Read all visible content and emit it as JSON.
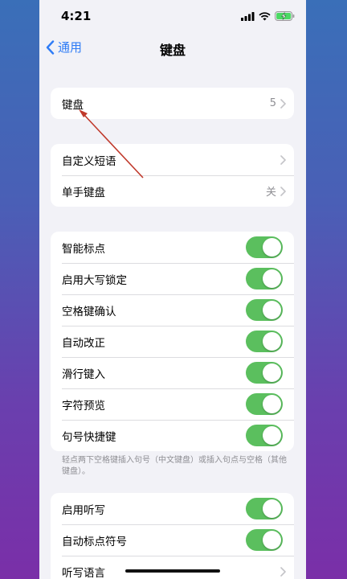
{
  "status": {
    "time": "4:21"
  },
  "nav": {
    "back_label": "通用",
    "title": "键盘"
  },
  "group1": {
    "keyboards": {
      "label": "键盘",
      "value": "5"
    }
  },
  "group2": {
    "text_replacement": {
      "label": "自定义短语"
    },
    "one_handed": {
      "label": "单手键盘",
      "value": "关"
    }
  },
  "toggles": [
    {
      "label": "智能标点",
      "on": true
    },
    {
      "label": "启用大写锁定",
      "on": true
    },
    {
      "label": "空格键确认",
      "on": true
    },
    {
      "label": "自动改正",
      "on": true
    },
    {
      "label": "滑行键入",
      "on": true
    },
    {
      "label": "字符预览",
      "on": true
    },
    {
      "label": "句号快捷键",
      "on": true
    }
  ],
  "footnote": "轻点两下空格键插入句号（中文键盘）或插入句点与空格（其他键盘）。",
  "dictation": {
    "enable": {
      "label": "启用听写",
      "on": true
    },
    "auto_punct": {
      "label": "自动标点符号",
      "on": true
    },
    "language": {
      "label": "听写语言"
    }
  },
  "colors": {
    "accent": "#2f7cf6",
    "toggle_on": "#5bbf5e",
    "annotation": "#c0392b"
  }
}
